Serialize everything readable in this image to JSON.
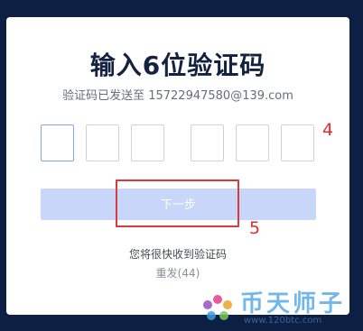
{
  "dialog": {
    "title": "输入6位验证码",
    "subtitle": "验证码已发送至 15722947580@139.com",
    "code_digits": [
      "",
      "",
      "",
      "",
      "",
      ""
    ],
    "next_button": "下一步",
    "hint": "您将很快收到验证码",
    "resend": "重发(44)"
  },
  "annotations": {
    "step_4": "4",
    "step_5": "5"
  },
  "watermark": {
    "text": "币天师子",
    "url": "www.120btc.com"
  },
  "colors": {
    "background": "#0e1f44",
    "button": "#c8d6fa",
    "annotation": "#e52b2b"
  }
}
